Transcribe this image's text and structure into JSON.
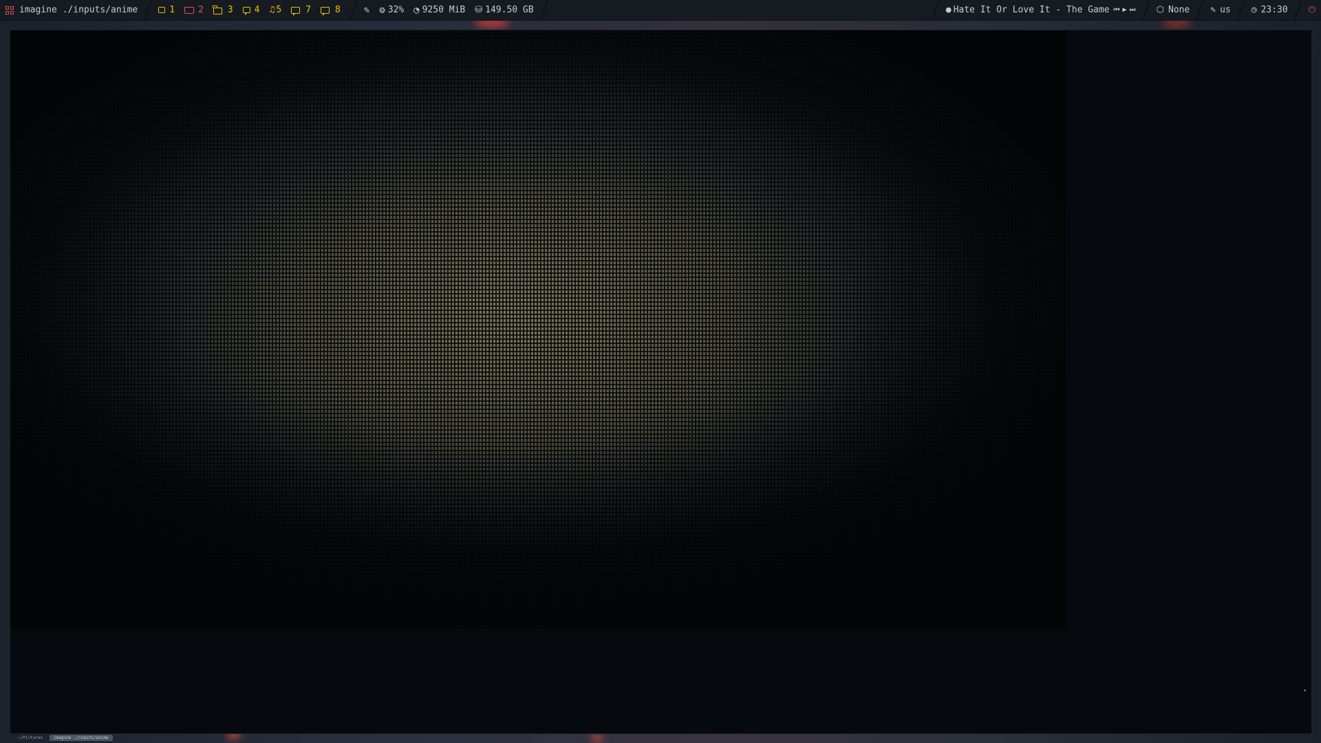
{
  "topbar": {
    "launcher_icon": "grid-icon",
    "window_title": "imagine ./inputs/anime",
    "workspaces": [
      {
        "num": "1",
        "icon": "box-icon",
        "color": "#e6c200"
      },
      {
        "num": "2",
        "icon": "box-icon",
        "color": "#e05252"
      },
      {
        "num": "3",
        "icon": "folder-icon",
        "color": "#e6c200"
      },
      {
        "num": "4",
        "icon": "chat-icon",
        "color": "#e6c200"
      },
      {
        "num": "5",
        "icon": "music-note-icon",
        "color": "#e6c200"
      },
      {
        "num": "7",
        "icon": "monitor-icon",
        "color": "#e6c200"
      },
      {
        "num": "8",
        "icon": "chat-icon",
        "color": "#e6c200"
      }
    ],
    "stats": {
      "pen_icon": "feather-icon",
      "cpu": "32%",
      "memory": "9250 MiB",
      "disk": "149.50 GB"
    },
    "media": {
      "track": "Hate It Or Love It - The Game",
      "prev_symbol": "⏮",
      "play_symbol": "▶",
      "next_symbol": "⏭"
    },
    "network": "None",
    "keyboard_layout": "us",
    "clock": "23:30"
  },
  "terminal": {
    "content": "ascii-art rendering"
  },
  "bottom": {
    "tab_path": "~/Pictures",
    "tab_command": "imagine ./inputs/anime"
  },
  "colors": {
    "accent_yellow": "#e6c200",
    "accent_red": "#e05252",
    "bar_bg": "#161b22",
    "window_bg": "#06090d"
  }
}
